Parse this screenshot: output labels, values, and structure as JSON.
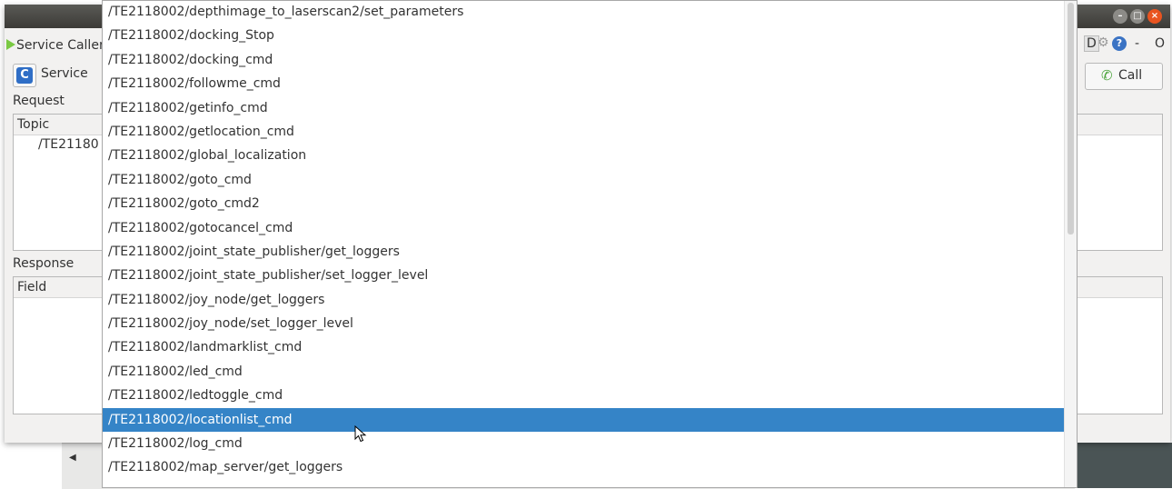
{
  "window": {
    "controls": [
      "–",
      "□",
      "×"
    ]
  },
  "plugin": {
    "title": "Service Caller",
    "right_icons": {
      "d_label": "D",
      "help": "?",
      "minus": "-",
      "close": "O"
    }
  },
  "toolbar": {
    "service_label": "Service",
    "call_label": "Call",
    "refresh_glyph": "C",
    "call_glyph": "✆"
  },
  "request": {
    "label": "Request",
    "column_topic": "Topic",
    "row_value": "/TE21180"
  },
  "response": {
    "label": "Response",
    "column_field": "Field"
  },
  "dropdown": {
    "items": [
      "/TE2118002/depthimage_to_laserscan2/set_parameters",
      "/TE2118002/docking_Stop",
      "/TE2118002/docking_cmd",
      "/TE2118002/followme_cmd",
      "/TE2118002/getinfo_cmd",
      "/TE2118002/getlocation_cmd",
      "/TE2118002/global_localization",
      "/TE2118002/goto_cmd",
      "/TE2118002/goto_cmd2",
      "/TE2118002/gotocancel_cmd",
      "/TE2118002/joint_state_publisher/get_loggers",
      "/TE2118002/joint_state_publisher/set_logger_level",
      "/TE2118002/joy_node/get_loggers",
      "/TE2118002/joy_node/set_logger_level",
      "/TE2118002/landmarklist_cmd",
      "/TE2118002/led_cmd",
      "/TE2118002/ledtoggle_cmd",
      "/TE2118002/locationlist_cmd",
      "/TE2118002/log_cmd",
      "/TE2118002/map_server/get_loggers"
    ],
    "selected_index": 17
  },
  "colors": {
    "selection": "#3584c7",
    "titlebar": "#3c3b37",
    "close_button": "#e95420",
    "play_icon": "#7ac943",
    "help_icon": "#3b73c4"
  },
  "icons": [
    "play-icon",
    "refresh-icon",
    "phone-icon",
    "gear-icon",
    "help-icon",
    "mouse-cursor-icon"
  ]
}
